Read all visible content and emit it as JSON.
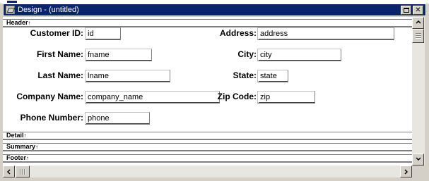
{
  "window": {
    "title": "Design - (untitled)",
    "restore_glyph": "restore-icon",
    "close_glyph": "✕"
  },
  "bands": {
    "header": "Header",
    "detail": "Detail",
    "summary": "Summary",
    "footer": "Footer",
    "arrow": "↑"
  },
  "form": {
    "customer_id": {
      "label": "Customer ID:",
      "value": "id"
    },
    "first_name": {
      "label": "First Name:",
      "value": "fname"
    },
    "last_name": {
      "label": "Last Name:",
      "value": "lname"
    },
    "company_name": {
      "label": "Company Name:",
      "value": "company_name"
    },
    "phone_number": {
      "label": "Phone Number:",
      "value": "phone"
    },
    "address": {
      "label": "Address:",
      "value": "address"
    },
    "city": {
      "label": "City:",
      "value": "city"
    },
    "state": {
      "label": "State:",
      "value": "state"
    },
    "zip_code": {
      "label": "Zip Code:",
      "value": "zip"
    }
  },
  "colors": {
    "title_bar": "#0a246a",
    "face": "#d4d0c8",
    "canvas": "#ffffff"
  }
}
